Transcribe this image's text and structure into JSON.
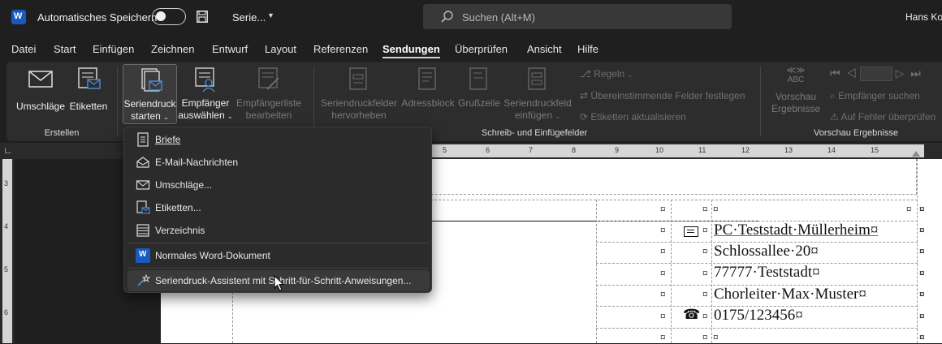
{
  "titlebar": {
    "autosave_label": "Automatisches Speichern",
    "doc_title": "Serie...",
    "search_placeholder": "Suchen (Alt+M)",
    "user_name": "Hans Ko"
  },
  "menu": {
    "items": [
      "Datei",
      "Start",
      "Einfügen",
      "Zeichnen",
      "Entwurf",
      "Layout",
      "Referenzen",
      "Sendungen",
      "Überprüfen",
      "Ansicht",
      "Hilfe"
    ],
    "active": "Sendungen"
  },
  "ribbon": {
    "erstellen": {
      "group_label": "Erstellen",
      "umschlaege": "Umschläge",
      "etiketten": "Etiketten"
    },
    "start": {
      "seriendruck_line1": "Seriendruck",
      "seriendruck_line2": "starten",
      "empfaenger_line1": "Empfänger",
      "empfaenger_line2": "auswählen",
      "empfaengerliste_line1": "Empfängerliste",
      "empfaengerliste_line2": "bearbeiten"
    },
    "schreib": {
      "group_label": "Schreib- und Einfügefelder",
      "hervorheben_line1": "Seriendruckfelder",
      "hervorheben_line2": "hervorheben",
      "adressblock": "Adressblock",
      "grusszeile": "Grußzeile",
      "feld_line1": "Seriendruckfeld",
      "feld_line2": "einfügen",
      "regeln": "Regeln",
      "felder_festlegen": "Übereinstimmende Felder festlegen",
      "etiketten_aktualisieren": "Etiketten aktualisieren"
    },
    "vorschau": {
      "group_label": "Vorschau Ergebnisse",
      "abc": "ABC",
      "vorschau_line1": "Vorschau",
      "vorschau_line2": "Ergebnisse",
      "empfaenger_suchen": "Empfänger suchen",
      "auf_fehler": "Auf Fehler überprüfen"
    }
  },
  "dropdown": {
    "items": [
      {
        "label": "Briefe",
        "icon": "letter-icon"
      },
      {
        "label": "E-Mail-Nachrichten",
        "icon": "email-icon"
      },
      {
        "label": "Umschläge...",
        "icon": "envelope-icon"
      },
      {
        "label": "Etiketten...",
        "icon": "labels-icon"
      },
      {
        "label": "Verzeichnis",
        "icon": "directory-icon"
      },
      {
        "label": "Normales Word-Dokument",
        "icon": "word-icon"
      },
      {
        "label": "Seriendruck-Assistent mit Schritt-für-Schritt-Anweisungen...",
        "icon": "wizard-icon"
      }
    ]
  },
  "ruler": {
    "ticks": [
      "5",
      "6",
      "7",
      "8",
      "9",
      "10",
      "11",
      "12",
      "13",
      "14",
      "15"
    ],
    "left_ticks": [
      "3",
      "4",
      "5",
      "6"
    ]
  },
  "document": {
    "lines": [
      "PC·Teststadt·Müllerheim¤",
      "Schlossallee·20¤",
      "77777·Teststadt¤",
      "Chorleiter·Max·Muster¤",
      "0175/123456¤"
    ],
    "cell_mark": "¤"
  },
  "colors": {
    "ribbon_bg": "#2d2d2d",
    "accent_blue": "#4a8fd8",
    "word_blue": "#185abd"
  }
}
